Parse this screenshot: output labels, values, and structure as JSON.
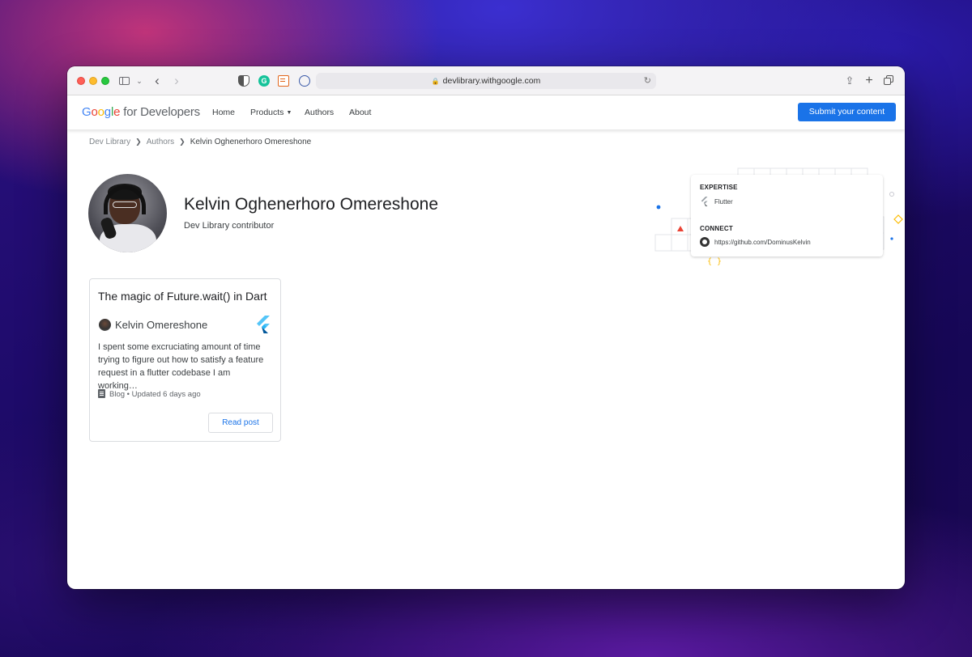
{
  "browser": {
    "url": "devlibrary.withgoogle.com"
  },
  "header": {
    "logo_google": [
      "G",
      "o",
      "o",
      "g",
      "l",
      "e"
    ],
    "logo_suffix": "for Developers",
    "nav": [
      "Home",
      "Products",
      "Authors",
      "About"
    ],
    "submit_label": "Submit your content"
  },
  "breadcrumb": [
    "Dev Library",
    "Authors",
    "Kelvin Oghenerhoro Omereshone"
  ],
  "profile": {
    "name": "Kelvin Oghenerhoro Omereshone",
    "role": "Dev Library contributor"
  },
  "info": {
    "expertise_label": "EXPERTISE",
    "expertise": "Flutter",
    "connect_label": "CONNECT",
    "github": "https://github.com/DominusKelvin"
  },
  "post": {
    "title": "The magic of Future.wait() in Dart",
    "author": "Kelvin Omereshone",
    "excerpt": "I spent some excruciating amount of time trying to figure out how to satisfy a feature request in a flutter codebase I am working…",
    "meta": "Blog • Updated 6 days ago",
    "read_label": "Read post"
  },
  "colors": {
    "accent": "#1a73e8",
    "text": "#202124"
  }
}
